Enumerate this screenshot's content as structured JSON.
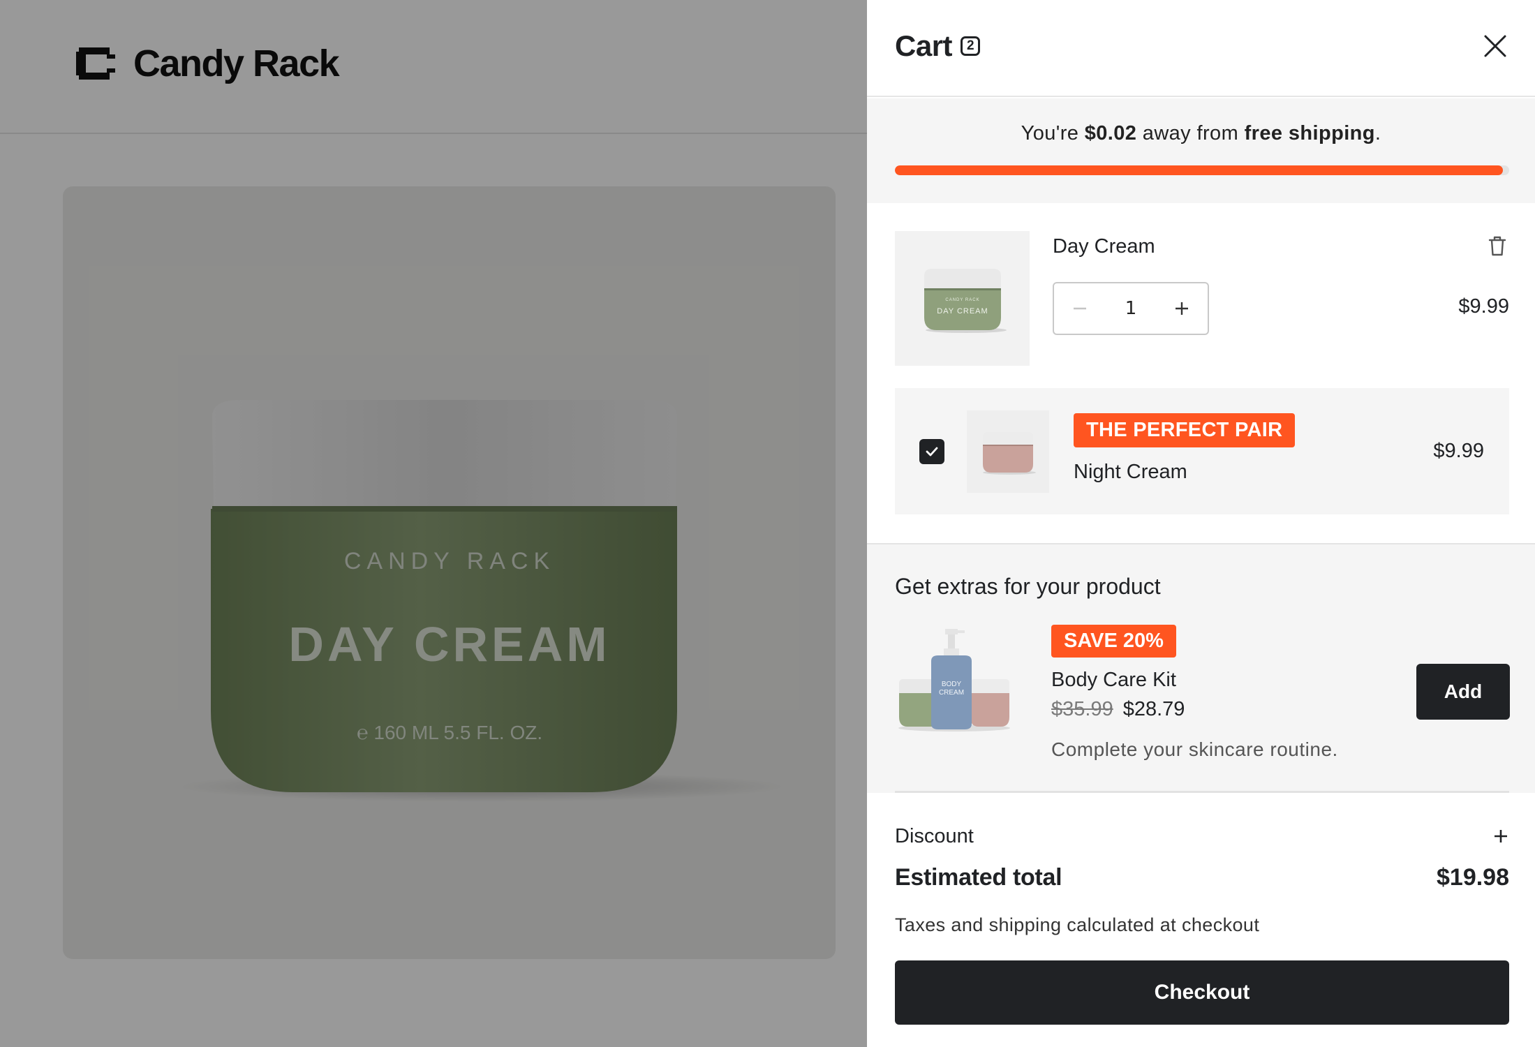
{
  "store": {
    "brand": "Candy Rack",
    "product_image": {
      "brand_text": "CANDY RACK",
      "product_text": "DAY CREAM",
      "size_text": "℮ 160 ML 5.5 FL. OZ."
    }
  },
  "cart": {
    "title": "Cart",
    "count": "2",
    "shipping": {
      "prefix": "You're ",
      "amount": "$0.02",
      "middle": " away from ",
      "goal": "free shipping",
      "suffix": ".",
      "progress_fraction": 0.99
    },
    "items": [
      {
        "name": "Day Cream",
        "quantity": "1",
        "price": "$9.99",
        "thumb_label": "DAY CREAM",
        "thumb_brand": "CANDY RACK"
      }
    ],
    "bundle": {
      "tag": "THE PERFECT PAIR",
      "name": "Night Cream",
      "price": "$9.99",
      "checked": true
    },
    "extras": {
      "title": "Get extras for your product",
      "tag": "SAVE 20%",
      "name": "Body Care Kit",
      "old_price": "$35.99",
      "new_price": "$28.79",
      "description": "Complete your skincare routine.",
      "add_label": "Add"
    },
    "discount_label": "Discount",
    "total_label": "Estimated total",
    "total_value": "$19.98",
    "tax_note": "Taxes and shipping calculated at checkout",
    "checkout_label": "Checkout"
  },
  "colors": {
    "accent": "#ff5520",
    "dark": "#202225",
    "jar_green": "#7d9167",
    "jar_lid": "#e6e6e6"
  }
}
